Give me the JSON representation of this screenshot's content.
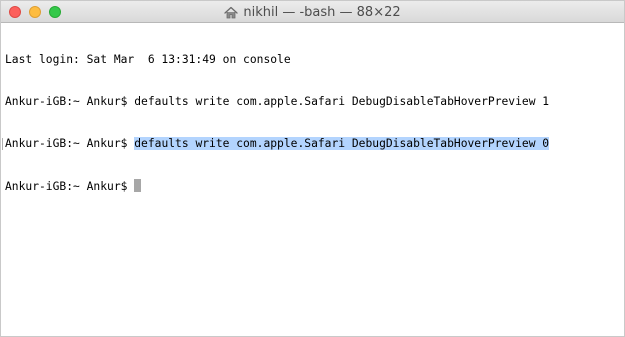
{
  "window": {
    "title": "nikhil — -bash — 88×22",
    "title_icon": "home-icon",
    "buttons": [
      "close",
      "minimize",
      "zoom"
    ]
  },
  "terminal": {
    "lines": [
      "Last login: Sat Mar  6 13:31:49 on console",
      {
        "prompt": "Ankur-iGB:~ Ankur$ ",
        "command": "defaults write com.apple.Safari DebugDisableTabHoverPreview 1"
      },
      {
        "prompt": "Ankur-iGB:~ Ankur$ ",
        "command": "defaults write com.apple.Safari DebugDisableTabHoverPreview 0",
        "selected": true
      },
      {
        "prompt": "Ankur-iGB:~ Ankur$ ",
        "command": ""
      }
    ]
  },
  "colors": {
    "selection": "#b3d4fe",
    "close": "#fc605c",
    "minimize": "#fdbc40",
    "zoom": "#34c84a",
    "cursor": "#a7a7a7"
  }
}
